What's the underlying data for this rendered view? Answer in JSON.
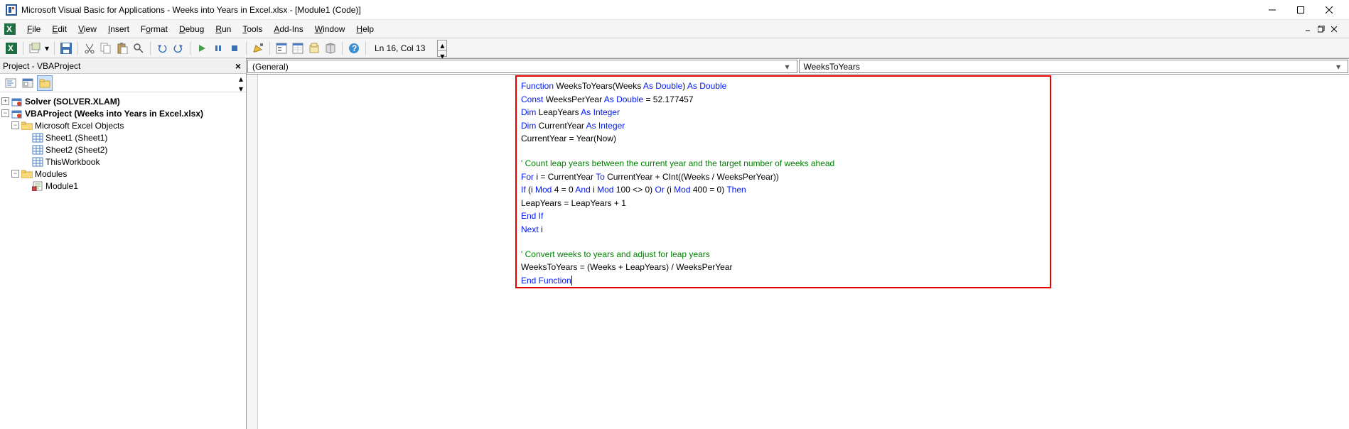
{
  "title": "Microsoft Visual Basic for Applications - Weeks into Years in Excel.xlsx - [Module1 (Code)]",
  "menu": {
    "file": "File",
    "edit": "Edit",
    "view": "View",
    "insert": "Insert",
    "format": "Format",
    "debug": "Debug",
    "run": "Run",
    "tools": "Tools",
    "addins": "Add-Ins",
    "window": "Window",
    "help": "Help"
  },
  "cursor_status": "Ln 16, Col 13",
  "project_panel_title": "Project - VBAProject",
  "tree": {
    "solver": "Solver (SOLVER.XLAM)",
    "vbaproject": "VBAProject (Weeks into Years in Excel.xlsx)",
    "excel_objects": "Microsoft Excel Objects",
    "sheet1": "Sheet1 (Sheet1)",
    "sheet2": "Sheet2 (Sheet2)",
    "thiswb": "ThisWorkbook",
    "modules": "Modules",
    "module1": "Module1"
  },
  "dropdowns": {
    "object": "(General)",
    "proc": "WeeksToYears"
  },
  "code": {
    "l1": {
      "a": "Function",
      "b": " WeeksToYears(Weeks ",
      "c": "As Double",
      "d": ") ",
      "e": "As Double"
    },
    "l2": {
      "a": "Const",
      "b": " WeeksPerYear ",
      "c": "As Double",
      "d": " = 52.177457"
    },
    "l3": {
      "a": "Dim",
      "b": " LeapYears ",
      "c": "As Integer"
    },
    "l4": {
      "a": "Dim",
      "b": " CurrentYear ",
      "c": "As Integer"
    },
    "l5": "CurrentYear = Year(Now)",
    "l7": "' Count leap years between the current year and the target number of weeks ahead",
    "l8": {
      "a": "For",
      "b": " i = CurrentYear ",
      "c": "To",
      "d": " CurrentYear + CInt((Weeks / WeeksPerYear))"
    },
    "l9": {
      "a": "If",
      "b": " (i ",
      "c": "Mod",
      "d": " 4 = 0 ",
      "e": "And",
      "f": " i ",
      "g": "Mod",
      "h": " 100 <> 0) ",
      "i": "Or",
      "j": " (i ",
      "k": "Mod",
      "l": " 400 = 0) ",
      "m": "Then"
    },
    "l10": "LeapYears = LeapYears + 1",
    "l11": "End If",
    "l12": {
      "a": "Next",
      "b": " i"
    },
    "l14": "' Convert weeks to years and adjust for leap years",
    "l15": "WeeksToYears = (Weeks + LeapYears) / WeeksPerYear",
    "l16": "End Function"
  }
}
